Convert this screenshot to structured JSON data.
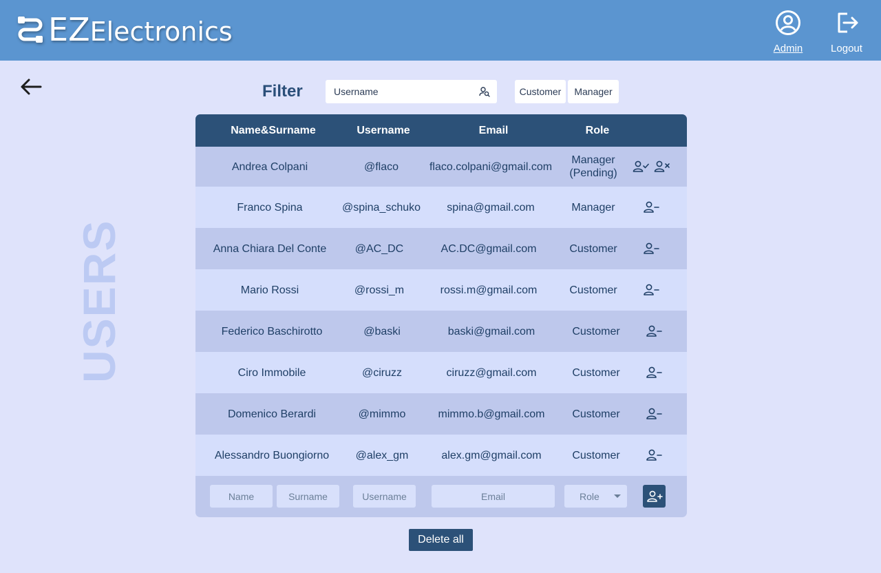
{
  "header": {
    "logo_ez": "EZ",
    "logo_rest": "Electronics",
    "admin_label": "Admin",
    "logout_label": "Logout"
  },
  "side_title": "USERS",
  "filter": {
    "label": "Filter",
    "placeholder": "Username",
    "role_customer": "Customer",
    "role_manager": "Manager"
  },
  "table": {
    "columns": [
      "Name&Surname",
      "Username",
      "Email",
      "Role"
    ],
    "rows": [
      {
        "name": "Andrea Colpani",
        "username": "@flaco",
        "email": "flaco.colpani@gmail.com",
        "role": "Manager (Pending)",
        "pending": true
      },
      {
        "name": "Franco Spina",
        "username": "@spina_schuko",
        "email": "spina@gmail.com",
        "role": "Manager",
        "pending": false
      },
      {
        "name": "Anna Chiara Del Conte",
        "username": "@AC_DC",
        "email": "AC.DC@gmail.com",
        "role": "Customer",
        "pending": false
      },
      {
        "name": "Mario Rossi",
        "username": "@rossi_m",
        "email": "rossi.m@gmail.com",
        "role": "Customer",
        "pending": false
      },
      {
        "name": "Federico Baschirotto",
        "username": "@baski",
        "email": "baski@gmail.com",
        "role": "Customer",
        "pending": false
      },
      {
        "name": "Ciro Immobile",
        "username": "@ciruzz",
        "email": "ciruzz@gmail.com",
        "role": "Customer",
        "pending": false
      },
      {
        "name": "Domenico Berardi",
        "username": "@mimmo",
        "email": "mimmo.b@gmail.com",
        "role": "Customer",
        "pending": false
      },
      {
        "name": "Alessandro Buongiorno",
        "username": "@alex_gm",
        "email": "alex.gm@gmail.com",
        "role": "Customer",
        "pending": false
      }
    ]
  },
  "add_form": {
    "name_placeholder": "Name",
    "surname_placeholder": "Surname",
    "username_placeholder": "Username",
    "email_placeholder": "Email",
    "role_value": "Role"
  },
  "delete_all_label": "Delete all",
  "icons": {
    "logo": "circuit-logo-icon",
    "admin": "user-circle-icon",
    "logout": "logout-icon",
    "back": "arrow-left-icon",
    "filter": "user-search-icon",
    "approve": "user-check-icon",
    "reject": "user-x-icon",
    "remove": "user-minus-icon",
    "add": "user-plus-icon"
  },
  "colors": {
    "topbar": "#5b95d0",
    "background": "#dfe3fb",
    "table_header": "#2c5178",
    "row_dark": "#bec8ec",
    "row_light": "#d5defc",
    "side_title": "#bccaf3"
  }
}
